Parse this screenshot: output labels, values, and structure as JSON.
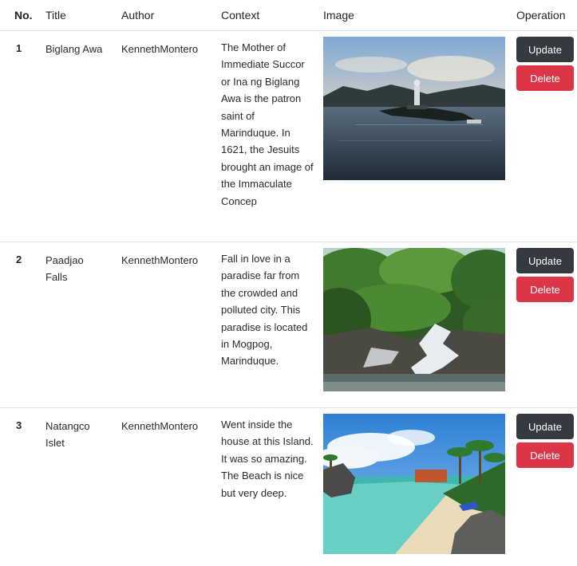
{
  "table": {
    "headers": {
      "no": "No.",
      "title": "Title",
      "author": "Author",
      "context": "Context",
      "image": "Image",
      "operation": "Operation"
    },
    "rows": [
      {
        "no": "1",
        "title": "Biglang Awa",
        "author": "KennethMontero",
        "context": "The Mother of Immediate Succor or Ina ng Biglang Awa is the patron saint of Marinduque. In 1621, the Jesuits brought an image of the Immaculate Concep",
        "image_subject": "lake-with-statue-photo",
        "update_label": "Update",
        "delete_label": "Delete"
      },
      {
        "no": "2",
        "title": "Paadjao Falls",
        "author": "KennethMontero",
        "context": "Fall in love in a paradise far from the crowded and polluted city. This paradise is located in Mogpog, Marinduque.",
        "image_subject": "waterfall-forest-photo",
        "update_label": "Update",
        "delete_label": "Delete"
      },
      {
        "no": "3",
        "title": "Natangco Islet",
        "author": "KennethMontero",
        "context": "Went inside the house at this Island. It was so amazing. The Beach is nice but very deep.",
        "image_subject": "beach-islet-photo",
        "update_label": "Update",
        "delete_label": "Delete"
      }
    ]
  },
  "colors": {
    "update_button": "#343a40",
    "delete_button": "#dc3545",
    "border": "#dee2e6"
  }
}
